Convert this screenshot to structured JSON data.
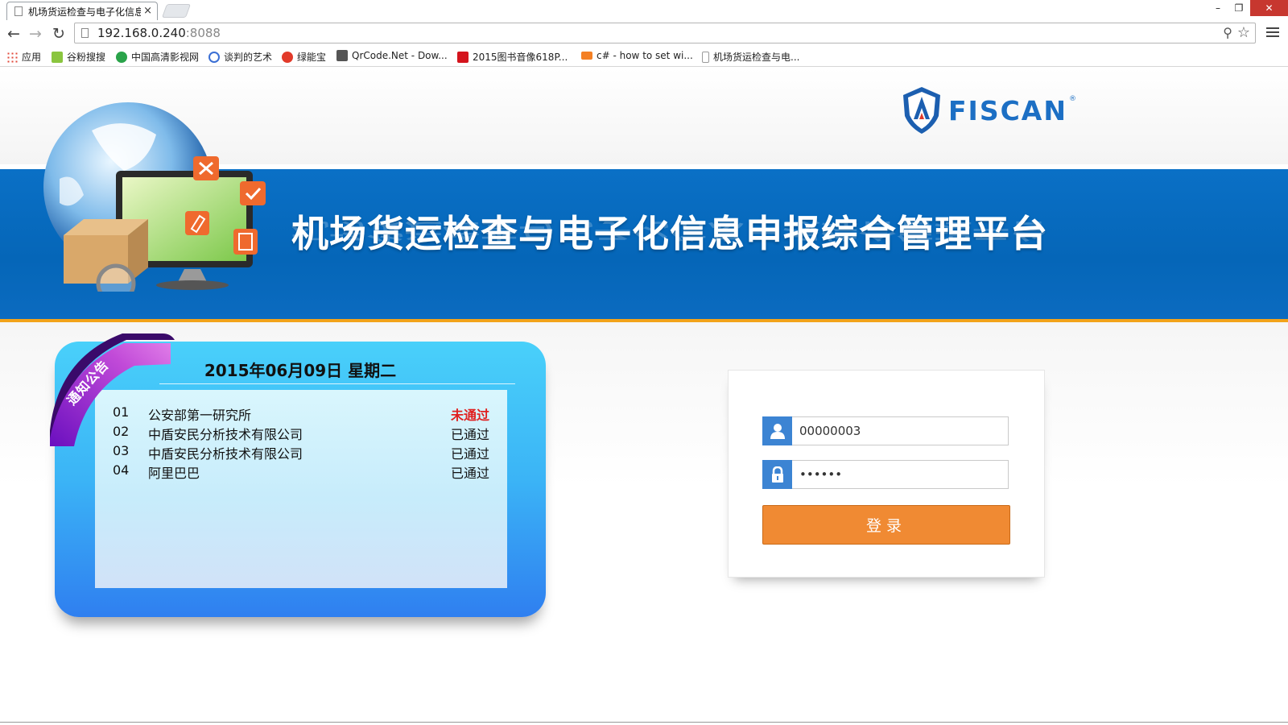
{
  "browser": {
    "tab_title": "机场货运检查与电子化信息申报综合管理平台",
    "tab_close": "×",
    "window_min": "–",
    "window_max": "❐",
    "window_close": "✕",
    "url_host": "192.168.0.240",
    "url_port": ":8088"
  },
  "bookmarks": [
    {
      "label": "应用",
      "icon": "apps-grid-icon",
      "color": "#e24a3b"
    },
    {
      "label": "谷粉搜搜",
      "icon": "bookmark-site-icon",
      "color": "#8ac53f"
    },
    {
      "label": "中国高清影视网",
      "icon": "bookmark-site-icon",
      "color": "#2aa34a"
    },
    {
      "label": "谈判的艺术",
      "icon": "play-circle-icon",
      "color": "#3b6fd4"
    },
    {
      "label": "绿能宝",
      "icon": "sohu-icon",
      "color": "#e23a2a"
    },
    {
      "label": "QrCode.Net - Dow...",
      "icon": "codeplex-icon",
      "color": "#555555"
    },
    {
      "label": "2015图书音像618P...",
      "icon": "jd-icon",
      "color": "#d4141d"
    },
    {
      "label": "c# - how to set wi...",
      "icon": "stackoverflow-icon",
      "color": "#f48024"
    },
    {
      "label": "机场货运检查与电...",
      "icon": "page-icon",
      "color": "#9a9a9a"
    }
  ],
  "header": {
    "logo_text": "FISCAN",
    "logo_reg": "®",
    "site_title": "机场货运检查与电子化信息申报综合管理平台"
  },
  "notice": {
    "ribbon_label": "通知公告",
    "date": "2015年06月09日 星期二",
    "items": [
      {
        "num": "01",
        "org": "公安部第一研究所",
        "status": "未通过"
      },
      {
        "num": "02",
        "org": "中盾安民分析技术有限公司",
        "status": "已通过"
      },
      {
        "num": "03",
        "org": "中盾安民分析技术有限公司",
        "status": "已通过"
      },
      {
        "num": "04",
        "org": "阿里巴巴",
        "status": "已通过"
      }
    ]
  },
  "login": {
    "username_value": "00000003",
    "password_value": "••••••",
    "submit_label": "登录"
  },
  "colors": {
    "banner_blue": "#0a6cc1",
    "accent_orange": "#f08a33",
    "fail_red": "#e02020"
  }
}
